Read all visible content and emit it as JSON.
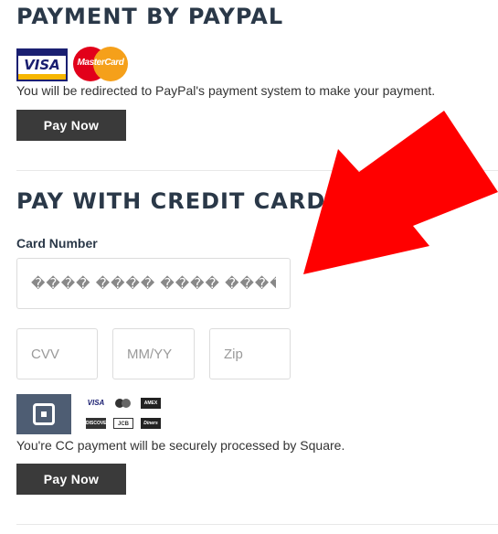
{
  "paypal": {
    "heading": "PAYMENT BY PAYPAL",
    "logos": {
      "visa": "VISA",
      "mastercard": "MasterCard"
    },
    "note": "You will be redirected to PayPal's payment system to make your payment.",
    "button_label": "Pay Now"
  },
  "credit_card": {
    "heading": "PAY WITH CREDIT CARD",
    "card_number_label": "Card Number",
    "card_number_placeholder": "���� ���� ���� ����",
    "cvv_placeholder": "CVV",
    "expiry_placeholder": "MM/YY",
    "zip_placeholder": "Zip",
    "brand_icons": {
      "visa": "VISA",
      "amex": "AMEX",
      "discover": "DISCOVER",
      "jcb": "JCB",
      "diners": "Diners"
    },
    "note": "You're CC payment will be securely processed by Square.",
    "button_label": "Pay Now"
  },
  "colors": {
    "heading": "#2a3848",
    "button_bg": "#3a3a3a",
    "arrow": "#ff0000",
    "square_logo": "#4e5d73"
  },
  "icons": {
    "arrow": "red-arrow-icon",
    "square": "square-logo-icon"
  }
}
